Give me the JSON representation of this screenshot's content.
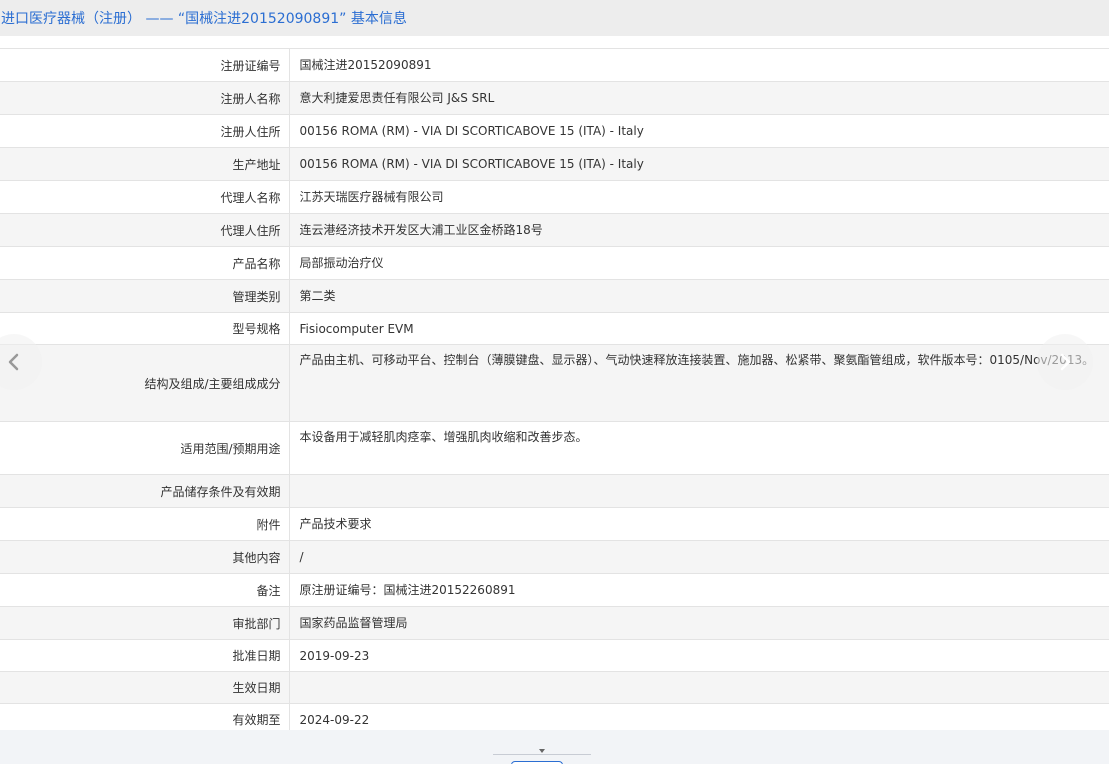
{
  "title": "进口医疗器械（注册） —— “国械注进20152090891” 基本信息",
  "rows": [
    {
      "label": "注册证编号",
      "value": "国械注进20152090891"
    },
    {
      "label": "注册人名称",
      "value": "意大利捷爱思责任有限公司 J&S SRL"
    },
    {
      "label": "注册人住所",
      "value": "00156 ROMA (RM) - VIA DI SCORTICABOVE 15 (ITA) - Italy"
    },
    {
      "label": "生产地址",
      "value": "00156 ROMA (RM) - VIA DI SCORTICABOVE 15 (ITA) - Italy"
    },
    {
      "label": "代理人名称",
      "value": "江苏天瑞医疗器械有限公司"
    },
    {
      "label": "代理人住所",
      "value": "连云港经济技术开发区大浦工业区金桥路18号"
    },
    {
      "label": "产品名称",
      "value": "局部振动治疗仪"
    },
    {
      "label": "管理类别",
      "value": "第二类"
    },
    {
      "label": "型号规格",
      "value": "Fisiocomputer EVM"
    },
    {
      "label": "结构及组成/主要组成成分",
      "value": "产品由主机、可移动平台、控制台（薄膜键盘、显示器）、气动快速释放连接装置、施加器、松紧带、聚氨酯管组成，软件版本号：0105/Nov/2013。"
    },
    {
      "label": "适用范围/预期用途",
      "value": "本设备用于减轻肌肉痉挛、增强肌肉收缩和改善步态。"
    },
    {
      "label": "产品储存条件及有效期",
      "value": ""
    },
    {
      "label": "附件",
      "value": "产品技术要求"
    },
    {
      "label": "其他内容",
      "value": "/"
    },
    {
      "label": "备注",
      "value": "原注册证编号：国械注进20152260891"
    },
    {
      "label": "审批部门",
      "value": "国家药品监督管理局"
    },
    {
      "label": "批准日期",
      "value": "2019-09-23"
    },
    {
      "label": "生效日期",
      "value": ""
    },
    {
      "label": "有效期至",
      "value": "2024-09-22"
    }
  ],
  "icons": {
    "prev": "chevron-left-icon",
    "next": "chevron-right-icon",
    "collapse": "caret-down-icon"
  },
  "colors": {
    "title": "#2b6ed2",
    "row_alt": "#f5f5f5",
    "border": "#e3e3e3"
  }
}
